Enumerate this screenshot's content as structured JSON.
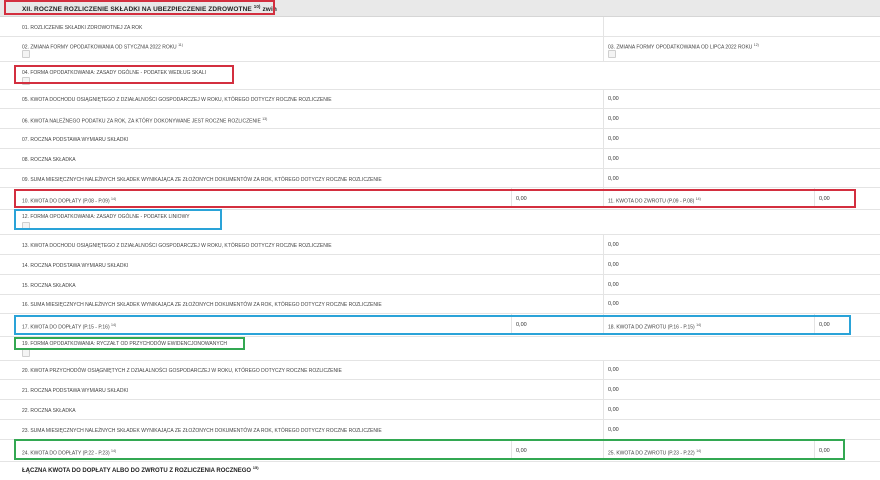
{
  "section": {
    "title": "XII. ROCZNE ROZLICZENIE SKŁADKI NA UBEZPIECZENIE ZDROWOTNE",
    "title_sup": "10)",
    "title_suffix": "zwin"
  },
  "rows": {
    "r01": {
      "label": "01. ROZLICZENIE SKŁADKI ZDROWOTNEJ ZA ROK"
    },
    "r02": {
      "label": "02. ZMIANA FORMY OPODATKOWANIA OD STYCZNIA 2022 ROKU",
      "sup": "11)"
    },
    "r03": {
      "label": "03. ZMIANA FORMY OPODATKOWANIA OD LIPCA 2022 ROKU",
      "sup": "12)"
    },
    "r04": {
      "label": "04. FORMA OPODATKOWANIA: ZASADY OGÓLNE - PODATEK WEDŁUG SKALI"
    },
    "r05": {
      "label": "05. KWOTA DOCHODU OSIĄGNIĘTEGO Z DZIAŁALNOŚCI GOSPODARCZEJ W ROKU, KTÓREGO DOTYCZY ROCZNE ROZLICZENIE",
      "value": "0,00"
    },
    "r06": {
      "label": "06. KWOTA NALEŻNEGO PODATKU ZA ROK, ZA KTÓRY DOKONYWANE JEST ROCZNE ROZLICZENIE",
      "sup": "13)",
      "value": "0,00"
    },
    "r07": {
      "label": "07. ROCZNA PODSTAWA WYMIARU SKŁADKI",
      "value": "0,00"
    },
    "r08": {
      "label": "08. ROCZNA SKŁADKA",
      "value": "0,00"
    },
    "r09": {
      "label": "09. SUMA MIESIĘCZNYCH NALEŻNYCH SKŁADEK WYNIKAJĄCA ZE ZŁOŻONYCH DOKUMENTÓW ZA ROK, KTÓREGO DOTYCZY ROCZNE ROZLICZENIE",
      "value": "0,00"
    },
    "r10": {
      "label": "10. KWOTA DO DOPŁATY (P.08 - P.09)",
      "sup": "14)",
      "value": "0,00"
    },
    "r11": {
      "label": "11. KWOTA DO ZWROTU (P.09 - P.08)",
      "sup": "14)",
      "value": "0,00"
    },
    "r12": {
      "label": "12. FORMA OPODATKOWANIA: ZASADY OGÓLNE - PODATEK LINIOWY"
    },
    "r13": {
      "label": "13. KWOTA DOCHODU OSIĄGNIĘTEGO Z DZIAŁALNOŚCI GOSPODARCZEJ W ROKU, KTÓREGO DOTYCZY ROCZNE ROZLICZENIE",
      "value": "0,00"
    },
    "r14": {
      "label": "14. ROCZNA PODSTAWA WYMIARU SKŁADKI",
      "value": "0,00"
    },
    "r15": {
      "label": "15. ROCZNA SKŁADKA",
      "value": "0,00"
    },
    "r16": {
      "label": "16. SUMA MIESIĘCZNYCH NALEŻNYCH SKŁADEK WYNIKAJĄCA ZE ZŁOŻONYCH DOKUMENTÓW ZA ROK, KTÓREGO DOTYCZY ROCZNE ROZLICZENIE",
      "value": "0,00"
    },
    "r17": {
      "label": "17. KWOTA DO DOPŁATY (P.15 - P.16)",
      "sup": "14)",
      "value": "0,00"
    },
    "r18": {
      "label": "18. KWOTA DO ZWROTU (P.16 - P.15)",
      "sup": "14)",
      "value": "0,00"
    },
    "r19": {
      "label": "19. FORMA OPODATKOWANIA: RYCZAŁT OD PRZYCHODÓW EWIDENCJONOWANYCH"
    },
    "r20": {
      "label": "20. KWOTA PRZYCHODÓW OSIĄGNIĘTYCH Z DZIAŁALNOŚCI GOSPODARCZEJ W ROKU, KTÓREGO DOTYCZY ROCZNE ROZLICZENIE",
      "value": "0,00"
    },
    "r21": {
      "label": "21. ROCZNA PODSTAWA WYMIARU SKŁADKI",
      "value": "0,00"
    },
    "r22": {
      "label": "22. ROCZNA SKŁADKA",
      "value": "0,00"
    },
    "r23": {
      "label": "23. SUMA MIESIĘCZNYCH NALEŻNYCH SKŁADEK WYNIKAJĄCA ZE ZŁOŻONYCH DOKUMENTÓW ZA ROK, KTÓREGO DOTYCZY ROCZNE ROZLICZENIE",
      "value": "0,00"
    },
    "r24": {
      "label": "24. KWOTA DO DOPŁATY (P.22 - P.23)",
      "sup": "14)",
      "value": "0,00"
    },
    "r25": {
      "label": "25. KWOTA DO ZWROTU (P.23 - P.22)",
      "sup": "14)",
      "value": "0,00"
    }
  },
  "footer": {
    "title": "ŁĄCZNA KWOTA DO DOPŁATY ALBO DO ZWROTU Z ROZLICZENIA ROCZNEGO",
    "sup": "15)"
  },
  "highlight_colors": {
    "red": "#d32f3f",
    "blue": "#2aa3d8",
    "green": "#33a852"
  }
}
